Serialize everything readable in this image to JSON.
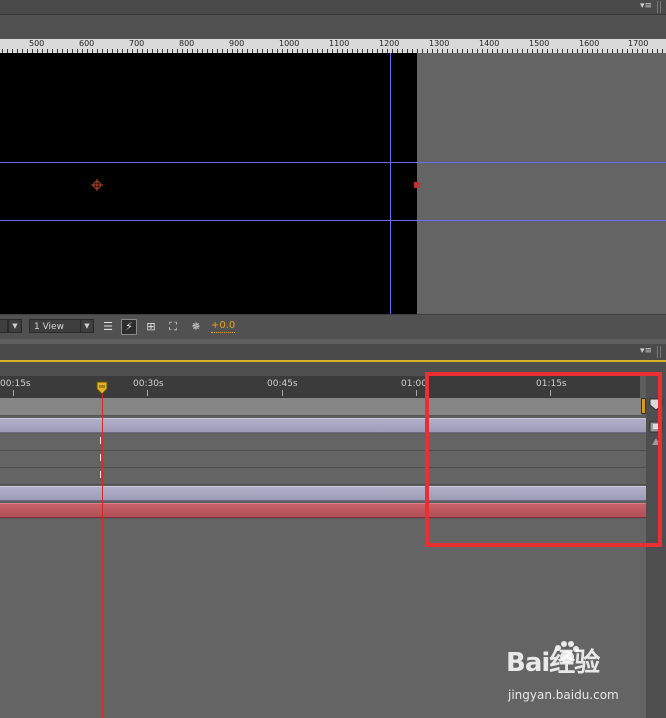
{
  "colors": {
    "accent_orange": "#e7a31b",
    "guide_blue": "#6a6cf0",
    "layer_lavender": "#a9a7bf",
    "layer_red": "#bb5860",
    "highlight_red": "#ea2f34",
    "time_indicator": "#d42a2a"
  },
  "top_panel": {
    "menu_icon": "panel-menu-icon"
  },
  "ruler": {
    "labels": [
      "500",
      "600",
      "700",
      "800",
      "900",
      "1000",
      "1100",
      "1200",
      "1300",
      "1400",
      "1500",
      "1600",
      "1700"
    ]
  },
  "viewer_toolbar": {
    "view_layout": "1 View",
    "exposure": "+0.0",
    "icons": [
      "grid-icon",
      "fast-preview-icon",
      "transparency-grid-icon",
      "flowchart-icon",
      "reset-exposure-icon"
    ]
  },
  "timeline": {
    "time_labels": [
      "00:15s",
      "00:30s",
      "00:45s",
      "01:00",
      "01:15s"
    ],
    "current_time_marker": "current-time-indicator-icon",
    "keyframe_symbol": "I"
  },
  "watermark": {
    "brand": "Bai经验",
    "site": "jingyan.baidu.com"
  }
}
